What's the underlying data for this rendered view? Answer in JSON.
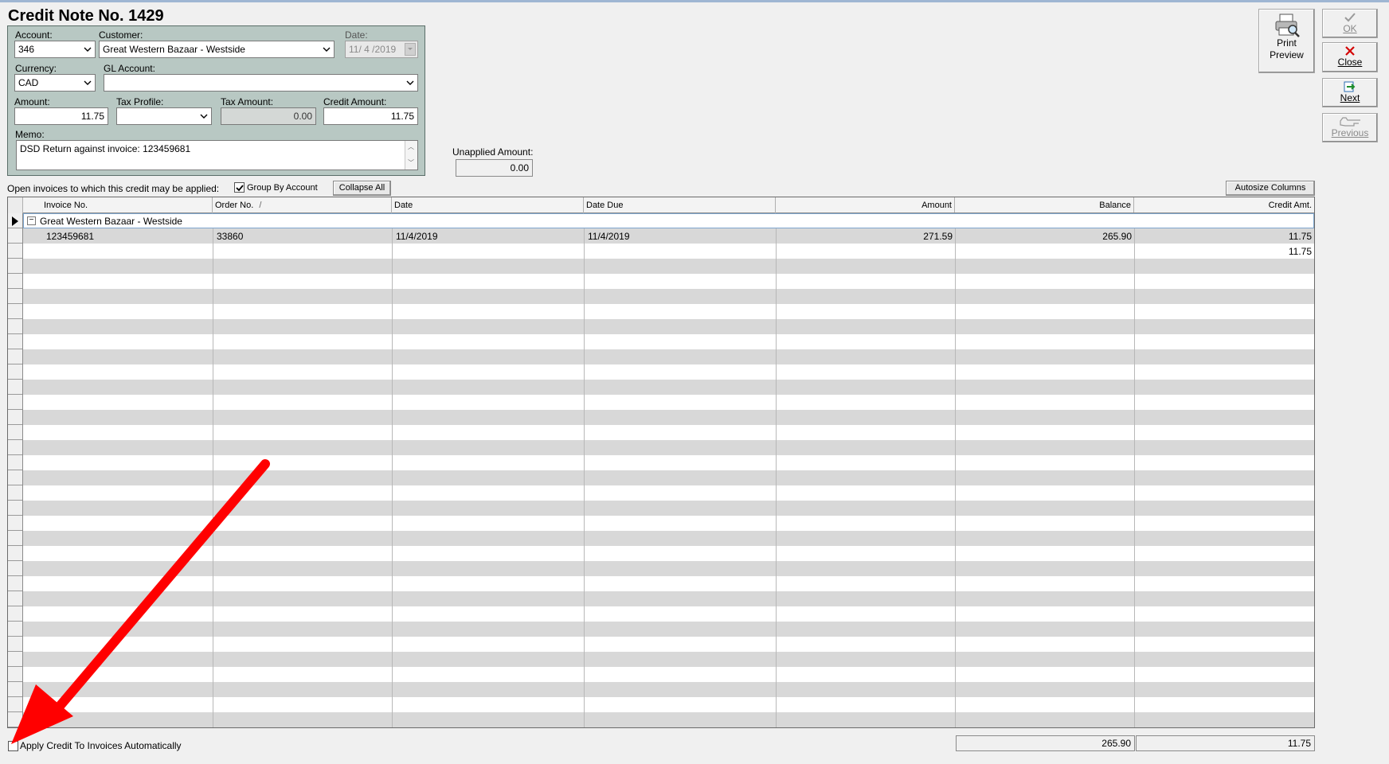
{
  "title": "Credit Note No. 1429",
  "header": {
    "account_label": "Account:",
    "account_value": "346",
    "customer_label": "Customer:",
    "customer_value": "Great Western Bazaar - Westside",
    "date_label": "Date:",
    "date_value": "11/ 4 /2019",
    "currency_label": "Currency:",
    "currency_value": "CAD",
    "gl_label": "GL Account:",
    "gl_value": "",
    "amount_label": "Amount:",
    "amount_value": "11.75",
    "tax_profile_label": "Tax Profile:",
    "tax_profile_value": "",
    "tax_amount_label": "Tax Amount:",
    "tax_amount_value": "0.00",
    "credit_amount_label": "Credit Amount:",
    "credit_amount_value": "11.75",
    "memo_label": "Memo:",
    "memo_value": "DSD Return against invoice: 123459681"
  },
  "unapplied": {
    "label": "Unapplied Amount:",
    "value": "0.00"
  },
  "toolbar": {
    "print_preview_line1": "Print",
    "print_preview_line2": "Preview",
    "ok": "OK",
    "close": "Close",
    "next": "Next",
    "previous": "Previous"
  },
  "grid_controls": {
    "open_invoices_label": "Open invoices to which this credit may be applied:",
    "group_by_label": "Group By Account",
    "group_by_checked": true,
    "collapse_all": "Collapse All",
    "autosize": "Autosize Columns"
  },
  "grid": {
    "columns": [
      "Invoice No.",
      "Order No.",
      "Date",
      "Date Due",
      "Amount",
      "Balance",
      "Credit Amt."
    ],
    "sort_indicator": "/",
    "group_name": "Great Western Bazaar - Westside",
    "group_expander": "−",
    "rows": [
      {
        "invoice": "123459681",
        "order": "33860",
        "date": "11/4/2019",
        "due": "11/4/2019",
        "amount": "271.59",
        "balance": "265.90",
        "credit": "11.75"
      }
    ],
    "group_total_credit": "11.75"
  },
  "footer": {
    "auto_apply_label": "Apply Credit To Invoices Automatically",
    "auto_apply_checked": false,
    "total_balance": "265.90",
    "total_credit": "11.75"
  },
  "colors": {
    "panel": "#b8c8c3",
    "row_alt": "#d8d8d8",
    "arrow": "#ff0000",
    "close_x": "#d40000"
  }
}
